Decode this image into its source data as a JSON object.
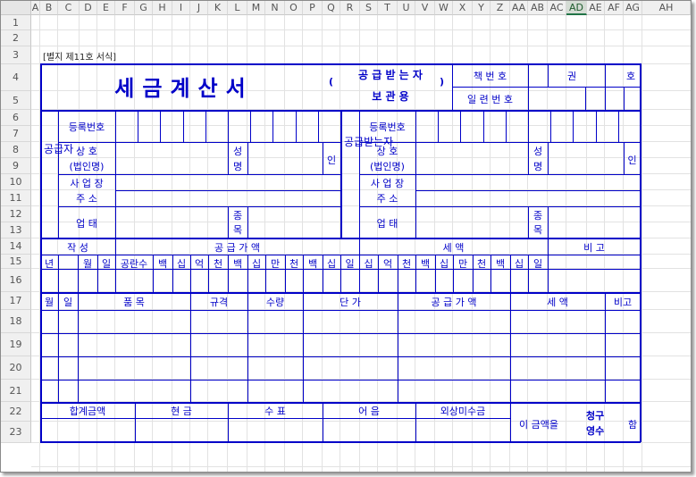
{
  "spreadsheet": {
    "columns": [
      "A",
      "B",
      "C",
      "D",
      "E",
      "F",
      "G",
      "H",
      "I",
      "J",
      "K",
      "L",
      "M",
      "N",
      "O",
      "P",
      "Q",
      "R",
      "S",
      "T",
      "U",
      "V",
      "W",
      "X",
      "Y",
      "Z",
      "AA",
      "AB",
      "AC",
      "AD",
      "AE",
      "AF",
      "AG",
      "AH"
    ],
    "selected_column": "AD",
    "rows": [
      "1",
      "2",
      "3",
      "4",
      "5",
      "6",
      "7",
      "8",
      "9",
      "10",
      "11",
      "12",
      "13",
      "14",
      "15",
      "16",
      "17",
      "18",
      "19",
      "20",
      "21",
      "22",
      "23"
    ]
  },
  "form": {
    "form_label": "[별지 제11호 서식]",
    "title": "세금계산서",
    "copy_line1": "공 급 받 는 자",
    "copy_line2": "보   관   용",
    "paren_open": "(",
    "paren_close": ")",
    "book_no_label": "책 번 호",
    "volume": "권",
    "number": "호",
    "serial_label": "일 련 번 호",
    "supplier_vertical": "공급자",
    "buyer_vertical": "공급받는자",
    "reg_no": "등록번호",
    "company_name_1": "상      호",
    "company_name_2": "(법인명)",
    "person_1": "성",
    "person_2": "명",
    "seal": "인",
    "address_1": "사 업 장",
    "address_2": "주      소",
    "business": "업      태",
    "item_1": "종",
    "item_2": "목",
    "date_written": "작      성",
    "supply_amount": "공    급    가    액",
    "tax_amount": "세          액",
    "remarks": "비      고",
    "year": "년",
    "month": "월",
    "day": "일",
    "blank_count": "공란수",
    "digits": [
      "백",
      "십",
      "억",
      "천",
      "백",
      "십",
      "만",
      "천",
      "백",
      "십",
      "일"
    ],
    "tax_digits": [
      "십",
      "억",
      "천",
      "백",
      "십",
      "만",
      "천",
      "백",
      "십",
      "일"
    ],
    "col_month": "월",
    "col_day": "일",
    "col_item": "품          목",
    "col_spec": "규격",
    "col_qty": "수량",
    "col_price": "단          가",
    "col_supply": "공 급 가 액",
    "col_tax": "세          액",
    "col_note": "비고",
    "total": "합계금액",
    "cash": "현   금",
    "check": "수   표",
    "note_bill": "어   음",
    "credit": "외상미수금",
    "this_amount": "이 금액을",
    "claim": "청구",
    "receipt": "영수",
    "ham": "함"
  }
}
